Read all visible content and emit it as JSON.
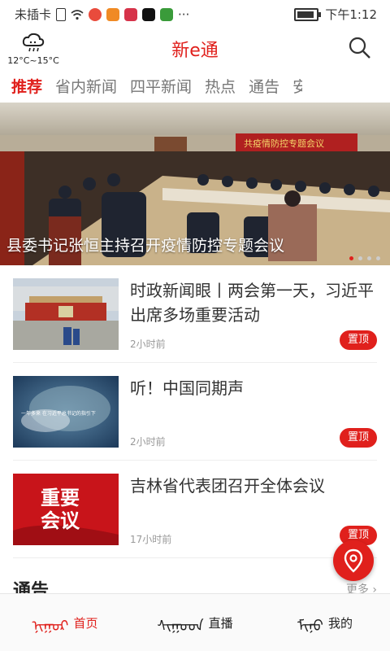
{
  "status_bar": {
    "left_text": "未插卡",
    "time": "下午1:12",
    "dots": "···"
  },
  "app_bar": {
    "weather_temp": "12°C~15°C",
    "title": "新e通"
  },
  "tabs": [
    {
      "label": "推荐"
    },
    {
      "label": "省内新闻"
    },
    {
      "label": "四平新闻"
    },
    {
      "label": "热点"
    },
    {
      "label": "通告"
    },
    {
      "label": "安"
    }
  ],
  "hero": {
    "caption": "县委书记张恒主持召开疫情防控专题会议",
    "banner": "共疫情防控专题会议",
    "slide_index": 1,
    "slide_count": 4
  },
  "news": [
    {
      "title": "时政新闻眼丨两会第一天，习近平出席多场重要活动",
      "time": "2小时前",
      "pin": "置顶"
    },
    {
      "title": "听！中国同期声",
      "time": "2小时前",
      "pin": "置顶",
      "thumb_text": "一年多来 在习近平总书记的指引下"
    },
    {
      "title": "吉林省代表团召开全体会议",
      "time": "17小时前",
      "pin": "置顶",
      "thumb_lines": [
        "重要",
        "会议"
      ]
    }
  ],
  "notice_section": {
    "title": "通告",
    "more": "更多"
  },
  "bottom_nav": [
    {
      "label": "首页",
      "glyph": "ᠨᠢᠭᠤᠷ",
      "active": true
    },
    {
      "label": "直播",
      "glyph": "ᠰᠢᠭᠤᠳ",
      "active": false
    },
    {
      "label": "我的",
      "glyph": "ᠮᠢᠨᠤ",
      "active": false
    }
  ],
  "colors": {
    "accent": "#e0201c"
  }
}
